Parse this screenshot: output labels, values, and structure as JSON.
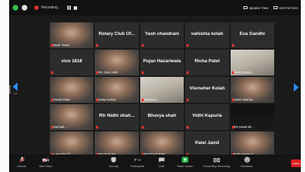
{
  "titlebar": {
    "recording_label": "Recording...",
    "speaker_view_label": "Speaker View",
    "exit_fullscreen_label": "Exit Full Scre"
  },
  "nav": {
    "page_left": "2/3"
  },
  "grid": {
    "rows": [
      [
        {
          "label": "Maitri Tanna",
          "style": "small",
          "video": "person"
        },
        {
          "label": "Rotary Club Of...",
          "style": "center"
        },
        {
          "label": "Yash chandrani",
          "style": "center"
        },
        {
          "label": "vahishta kolah",
          "style": "center"
        },
        {
          "label": "Eva Gandhi",
          "style": "center"
        }
      ],
      [
        {
          "label": "vivo 1818",
          "style": "center"
        },
        {
          "label": "Rtr. Garv Joshi",
          "style": "small",
          "video": "person"
        },
        {
          "label": "Pujan Hazariwala",
          "style": "center"
        },
        {
          "label": "Richa Patel",
          "style": "center"
        },
        {
          "label": "Sneha Bhatia",
          "style": "small",
          "video": "room"
        }
      ],
      [
        {
          "label": "Khushi Patel",
          "style": "small",
          "video": "person"
        },
        {
          "label": "Daisy Kochar",
          "style": "small",
          "video": "person"
        },
        {
          "label": "Lukshana...",
          "style": "small",
          "video": "room"
        },
        {
          "label": "Visrneher Kolah",
          "style": "center"
        },
        {
          "label": "Harsh Sharma",
          "style": "small",
          "video": "person"
        }
      ],
      [
        {
          "label": "Samvad...",
          "style": "small",
          "video": "person"
        },
        {
          "label": "Rtr Nidhi shah...",
          "style": "center"
        },
        {
          "label": "Bhavya shah",
          "style": "center"
        },
        {
          "label": "Vidhi Kapuria",
          "style": "center"
        },
        {
          "label": "Rtr Janaki Mi...",
          "style": "small",
          "video": "dark"
        }
      ],
      [
        {
          "label": "Lokendra Ch...",
          "style": "small",
          "video": "person"
        },
        {
          "label": "Rtr.Vrushi Pa...",
          "style": "small",
          "video": "person"
        },
        {
          "label": "Rtr.Dimpal Patel",
          "style": "small",
          "video": "person"
        },
        {
          "label": "Patel Jainil",
          "style": "center"
        },
        {
          "label": "Rajh Hassan S...",
          "style": "small",
          "video": "person"
        }
      ]
    ]
  },
  "toolbar": {
    "unmute": "Unmute",
    "start_video": "Start Video",
    "security": "Security",
    "participants": "Participants",
    "participants_count": "41",
    "chat": "Chat",
    "share_screen": "Share Screen",
    "pause_stop_recording": "Pause/Stop Recording",
    "reactions": "Reactions",
    "leave": "Leave"
  },
  "colors": {
    "accent_green": "#2fc14d",
    "mute_red": "#e33333",
    "leave_red": "#dd2222",
    "nav_blue": "#2d8cff"
  }
}
